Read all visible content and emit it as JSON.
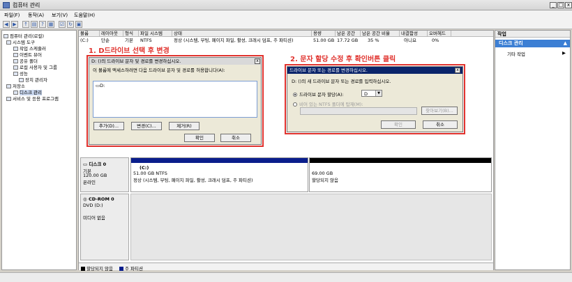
{
  "window": {
    "title": "컴퓨터 관리",
    "minimize": "_",
    "maximize": "□",
    "close": "x"
  },
  "menu": [
    "파일(F)",
    "동작(A)",
    "보기(V)",
    "도움말(H)"
  ],
  "tree": [
    {
      "label": "컴퓨터 관리(로컬)",
      "indent": 0
    },
    {
      "label": "시스템 도구",
      "indent": 1
    },
    {
      "label": "작업 스케줄러",
      "indent": 2
    },
    {
      "label": "이벤트 뷰어",
      "indent": 2
    },
    {
      "label": "공유 폴더",
      "indent": 2
    },
    {
      "label": "로컬 사용자 및 그룹",
      "indent": 2
    },
    {
      "label": "성능",
      "indent": 2
    },
    {
      "label": "장치 관리자",
      "indent": 2
    },
    {
      "label": "저장소",
      "indent": 1
    },
    {
      "label": "디스크 관리",
      "indent": 2,
      "selected": true
    },
    {
      "label": "서비스 및 응용 프로그램",
      "indent": 1
    }
  ],
  "volume_table": {
    "headers": [
      "볼륨",
      "레이아웃",
      "형식",
      "파일 시스템",
      "상태",
      "용량",
      "남은 공간",
      "남은 공간 비율",
      "내결함성",
      "오버헤드"
    ],
    "rows": [
      [
        "(C:)",
        "단순",
        "기본",
        "NTFS",
        "정상 (시스템, 부팅, 페이지 파일, 활성, 크래시 덤프, 주 파티션)",
        "51.00 GB",
        "17.72 GB",
        "35 %",
        "아니요",
        "0%"
      ]
    ]
  },
  "annotations": {
    "step1": "1. D드라이브 선택 후 변경",
    "step2": "2. 문자 할당 수정 후 확인버튼 클릭"
  },
  "dialog1": {
    "title": "D: ()의 드라이브 문자 및 경로를 변경하십시오.",
    "description": "이 볼륨에 액세스하려면 다음 드라이브 문자 및 경로를 허용합니다(A):",
    "list_item": "D:",
    "btn_add": "추가(D)...",
    "btn_change": "변경(C)...",
    "btn_remove": "제거(R)",
    "btn_ok": "확인",
    "btn_cancel": "취소"
  },
  "dialog2": {
    "title": "드라이브 문자 또는 경로를 변경하십시오.",
    "description": "D: ()의 새 드라이브 문자 또는 경로를 입력하십시오.",
    "opt_assign": "드라이브 문자 할당(A):",
    "drive_letter": "D",
    "opt_mount": "비어 있는 NTFS 폴더에 탑재(M):",
    "btn_browse": "찾아보기(B)...",
    "btn_ok": "확인",
    "btn_cancel": "취소"
  },
  "disks": [
    {
      "name": "디스크 0",
      "type": "기본",
      "size": "120.00 GB",
      "status": "온라인",
      "partitions": [
        {
          "name": "(C:)",
          "line1": "51.00 GB NTFS",
          "line2": "정상 (시스템, 부팅, 페이지 파일, 활성, 크래시 덤프, 주 파티션)",
          "bar": "#0a1e8c"
        },
        {
          "name": "",
          "line1": "69.00 GB",
          "line2": "할당되지 않음",
          "bar": "#000000"
        }
      ]
    },
    {
      "name": "CD-ROM 0",
      "type": "DVD (D:)",
      "size": "",
      "status": "미디어 없음"
    }
  ],
  "legend": [
    {
      "label": "할당되지 않음",
      "color": "#000000"
    },
    {
      "label": "주 파티션",
      "color": "#0a1e8c"
    }
  ],
  "actions": {
    "header": "작업",
    "selected": "디스크 관리",
    "item": "기타 작업"
  }
}
